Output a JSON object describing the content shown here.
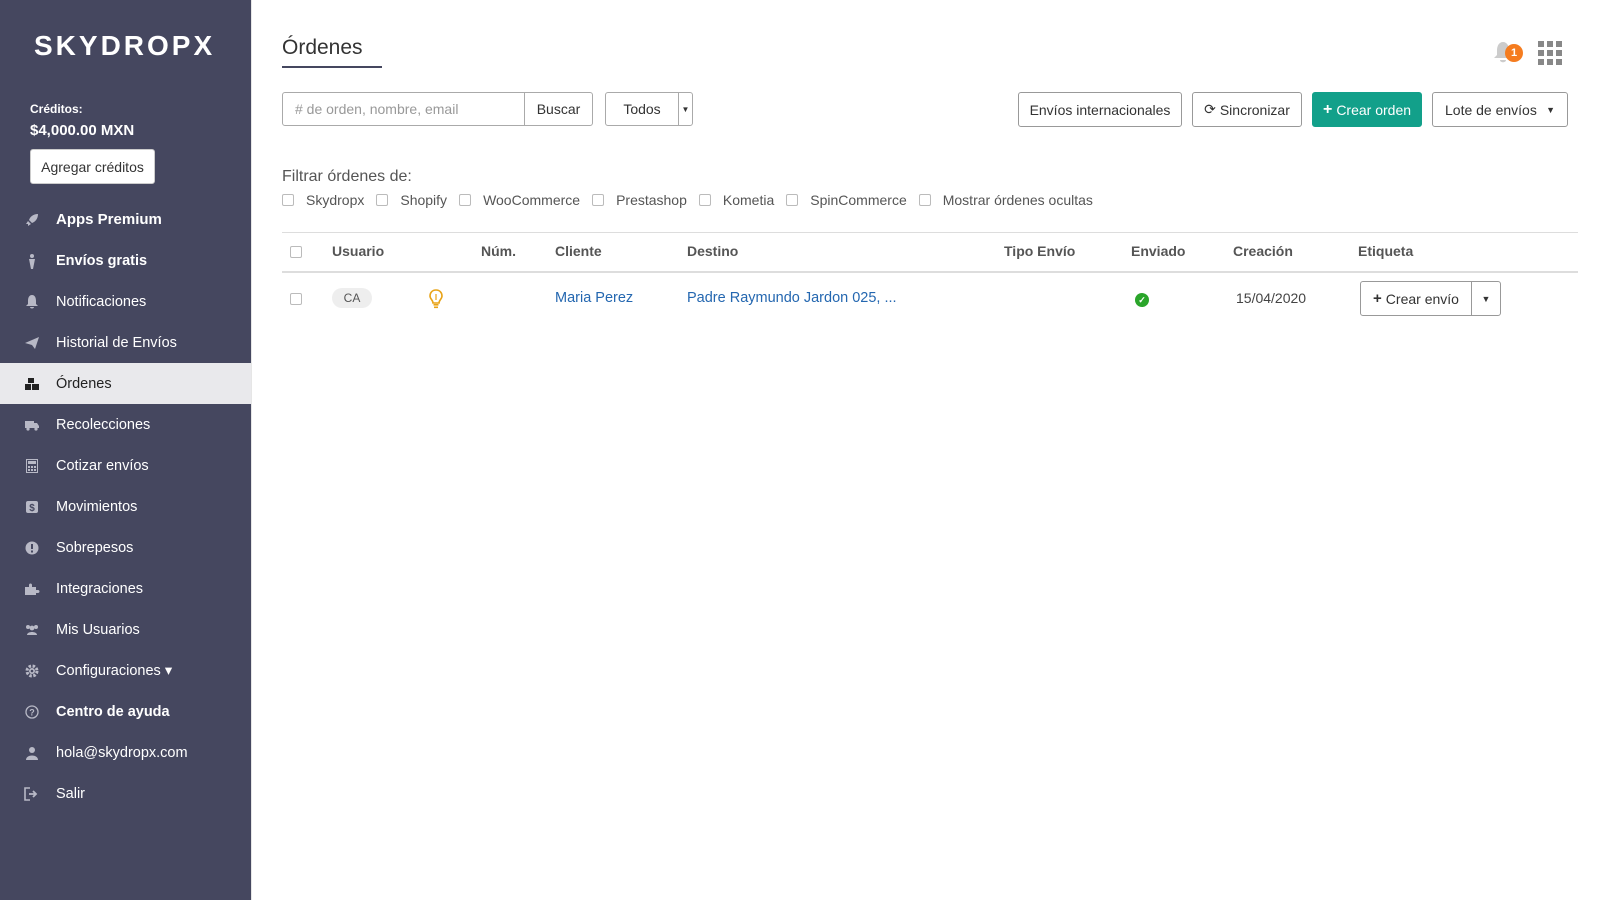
{
  "brand": {
    "logo_text": "SKYDROPX"
  },
  "credits": {
    "label": "Créditos:",
    "amount": "$4,000.00 MXN",
    "add_label": "Agregar créditos"
  },
  "sidebar": {
    "items": [
      {
        "label": "Apps Premium",
        "icon": "rocket-icon"
      },
      {
        "label": "Envíos gratis",
        "icon": "person-icon"
      },
      {
        "label": "Notificaciones",
        "icon": "bell-icon"
      },
      {
        "label": "Historial de Envíos",
        "icon": "paper-plane-icon"
      },
      {
        "label": "Órdenes",
        "icon": "boxes-icon",
        "active": true
      },
      {
        "label": "Recolecciones",
        "icon": "truck-icon"
      },
      {
        "label": "Cotizar envíos",
        "icon": "calculator-icon"
      },
      {
        "label": "Movimientos",
        "icon": "dollar-icon"
      },
      {
        "label": "Sobrepesos",
        "icon": "alert-icon"
      },
      {
        "label": "Integraciones",
        "icon": "puzzle-icon"
      },
      {
        "label": "Mis Usuarios",
        "icon": "users-icon"
      },
      {
        "label": "Configuraciones ▾",
        "icon": "gear-icon"
      },
      {
        "label": "Centro de ayuda",
        "icon": "help-icon"
      },
      {
        "label": "hola@skydropx.com",
        "icon": "user-icon"
      },
      {
        "label": "Salir",
        "icon": "sign-out-icon"
      }
    ]
  },
  "header": {
    "title": "Órdenes",
    "notification_count": "1"
  },
  "search": {
    "placeholder": "# de orden, nombre, email",
    "button_label": "Buscar",
    "filter_value": "Todos"
  },
  "toolbar": {
    "intl_label": "Envíos internacionales",
    "sync_label": "Sincronizar",
    "create_label": "Crear orden",
    "batch_label": "Lote de envíos"
  },
  "filters": {
    "label": "Filtrar órdenes de:",
    "options": [
      "Skydropx",
      "Shopify",
      "WooCommerce",
      "Prestashop",
      "Kometia",
      "SpinCommerce",
      "Mostrar órdenes ocultas"
    ]
  },
  "table": {
    "columns": [
      "Usuario",
      "Núm.",
      "Cliente",
      "Destino",
      "Tipo Envío",
      "Enviado",
      "Creación",
      "Etiqueta"
    ],
    "rows": [
      {
        "user": "CA",
        "num": "",
        "client": "Maria Perez",
        "destination": "Padre Raymundo Jardon 025, ...",
        "type": "",
        "sent": true,
        "created": "15/04/2020",
        "action_label": "Crear envío"
      }
    ]
  },
  "colors": {
    "sidebar": "#45475f",
    "accent": "#12a08a",
    "badge": "#f57c1f",
    "link": "#2467b0",
    "success": "#2aa52a"
  }
}
